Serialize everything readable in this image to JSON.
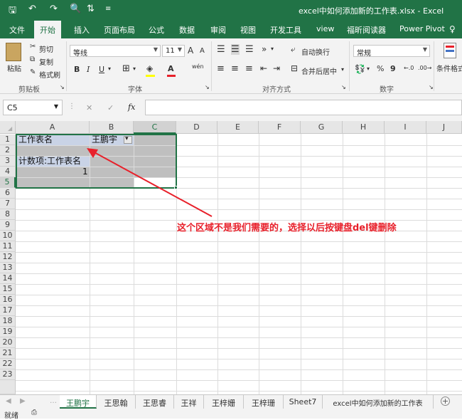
{
  "titlebar": {
    "title": "excel中如何添加新的工作表.xlsx - Excel",
    "quick_access": {
      "save": "🖫",
      "undo": "↶",
      "redo": "↷",
      "preview": "🔍",
      "sort": "⇅",
      "more": "≡"
    }
  },
  "ribbon_tabs": [
    "文件",
    "开始",
    "插入",
    "页面布局",
    "公式",
    "数据",
    "审阅",
    "视图",
    "开发工具",
    "view",
    "福昕阅读器",
    "Power Pivot"
  ],
  "active_tab": "开始",
  "clipboard": {
    "paste": "粘贴",
    "cut": "剪切",
    "copy": "复制",
    "format_painter": "格式刷",
    "label": "剪贴板"
  },
  "font": {
    "name": "等线",
    "size": "11",
    "grow": "A",
    "shrink": "A",
    "bold": "B",
    "italic": "I",
    "underline": "U",
    "phonetic": "wén",
    "label": "字体"
  },
  "alignment": {
    "wrap": "自动换行",
    "merge": "合并后居中",
    "label": "对齐方式"
  },
  "number": {
    "format": "常规",
    "percent": "%",
    "comma": "9",
    "label": "数字"
  },
  "styles": {
    "conditional": "条件格式"
  },
  "formula_bar": {
    "name_box": "C5",
    "fx": "fx",
    "cancel": "✕",
    "enter": "✓"
  },
  "columns": [
    "A",
    "B",
    "C",
    "D",
    "E",
    "F",
    "G",
    "H",
    "I",
    "J"
  ],
  "rows": [
    "1",
    "2",
    "3",
    "4",
    "5",
    "6",
    "7",
    "8",
    "9",
    "10",
    "11",
    "12",
    "13",
    "14",
    "15",
    "16",
    "17",
    "18",
    "19",
    "20",
    "21",
    "22",
    "23"
  ],
  "cells": {
    "a1": "工作表名",
    "b1": "王鹏宇",
    "a3": "计数项:工作表名",
    "a4": "1"
  },
  "annotation": "这个区域不是我们需要的，选择以后按键盘del键删除",
  "sheet_tabs": [
    "王鹏宇",
    "王思翰",
    "王思睿",
    "王祥",
    "王梓姗",
    "王梓珊",
    "Sheet7",
    "excel中如何添加新的工作表"
  ],
  "active_sheet": "王鹏宇",
  "status": {
    "ready": "就绪"
  },
  "colors": {
    "accent": "#217346",
    "annotation": "#e8202a",
    "pivot_header": "#c9d3e6",
    "pivot_fill": "#bfbfbf"
  }
}
